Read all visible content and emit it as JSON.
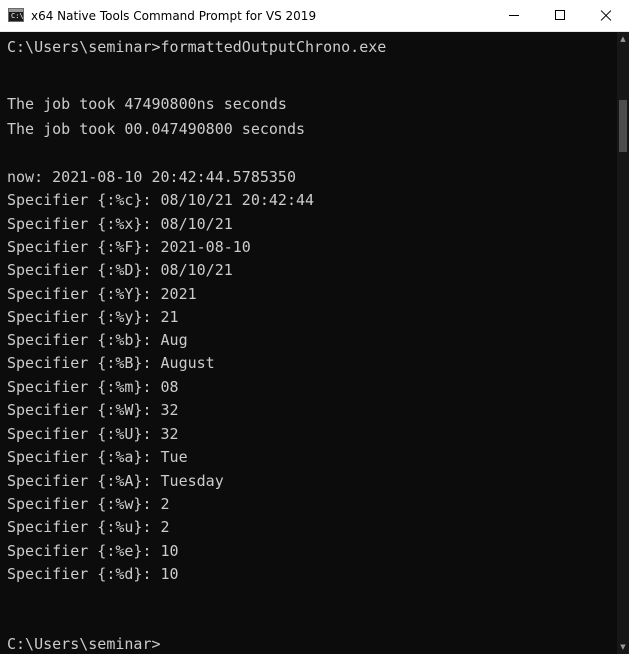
{
  "window": {
    "title": "x64 Native Tools Command Prompt for VS 2019",
    "icon_label": "C:\\",
    "buttons": {
      "minimize_icon": "minimize-icon",
      "maximize_icon": "maximize-icon",
      "close_icon": "close-icon"
    }
  },
  "console": {
    "lines": [
      "C:\\Users\\seminar>formattedOutputChrono.exe",
      "",
      "The job took 47490800ns seconds",
      "The job took 00.047490800 seconds",
      "",
      "now: 2021-08-10 20:42:44.5785350",
      "Specifier {:%c}: 08/10/21 20:42:44",
      "Specifier {:%x}: 08/10/21",
      "Specifier {:%F}: 2021-08-10",
      "Specifier {:%D}: 08/10/21",
      "Specifier {:%Y}: 2021",
      "Specifier {:%y}: 21",
      "Specifier {:%b}: Aug",
      "Specifier {:%B}: August",
      "Specifier {:%m}: 08",
      "Specifier {:%W}: 32",
      "Specifier {:%U}: 32",
      "Specifier {:%a}: Tue",
      "Specifier {:%A}: Tuesday",
      "Specifier {:%w}: 2",
      "Specifier {:%u}: 2",
      "Specifier {:%e}: 10",
      "Specifier {:%d}: 10",
      "",
      "",
      "C:\\Users\\seminar>"
    ]
  },
  "colors": {
    "console_background": "#0c0c0c",
    "console_text": "#cccccc",
    "titlebar_background": "#ffffff"
  }
}
